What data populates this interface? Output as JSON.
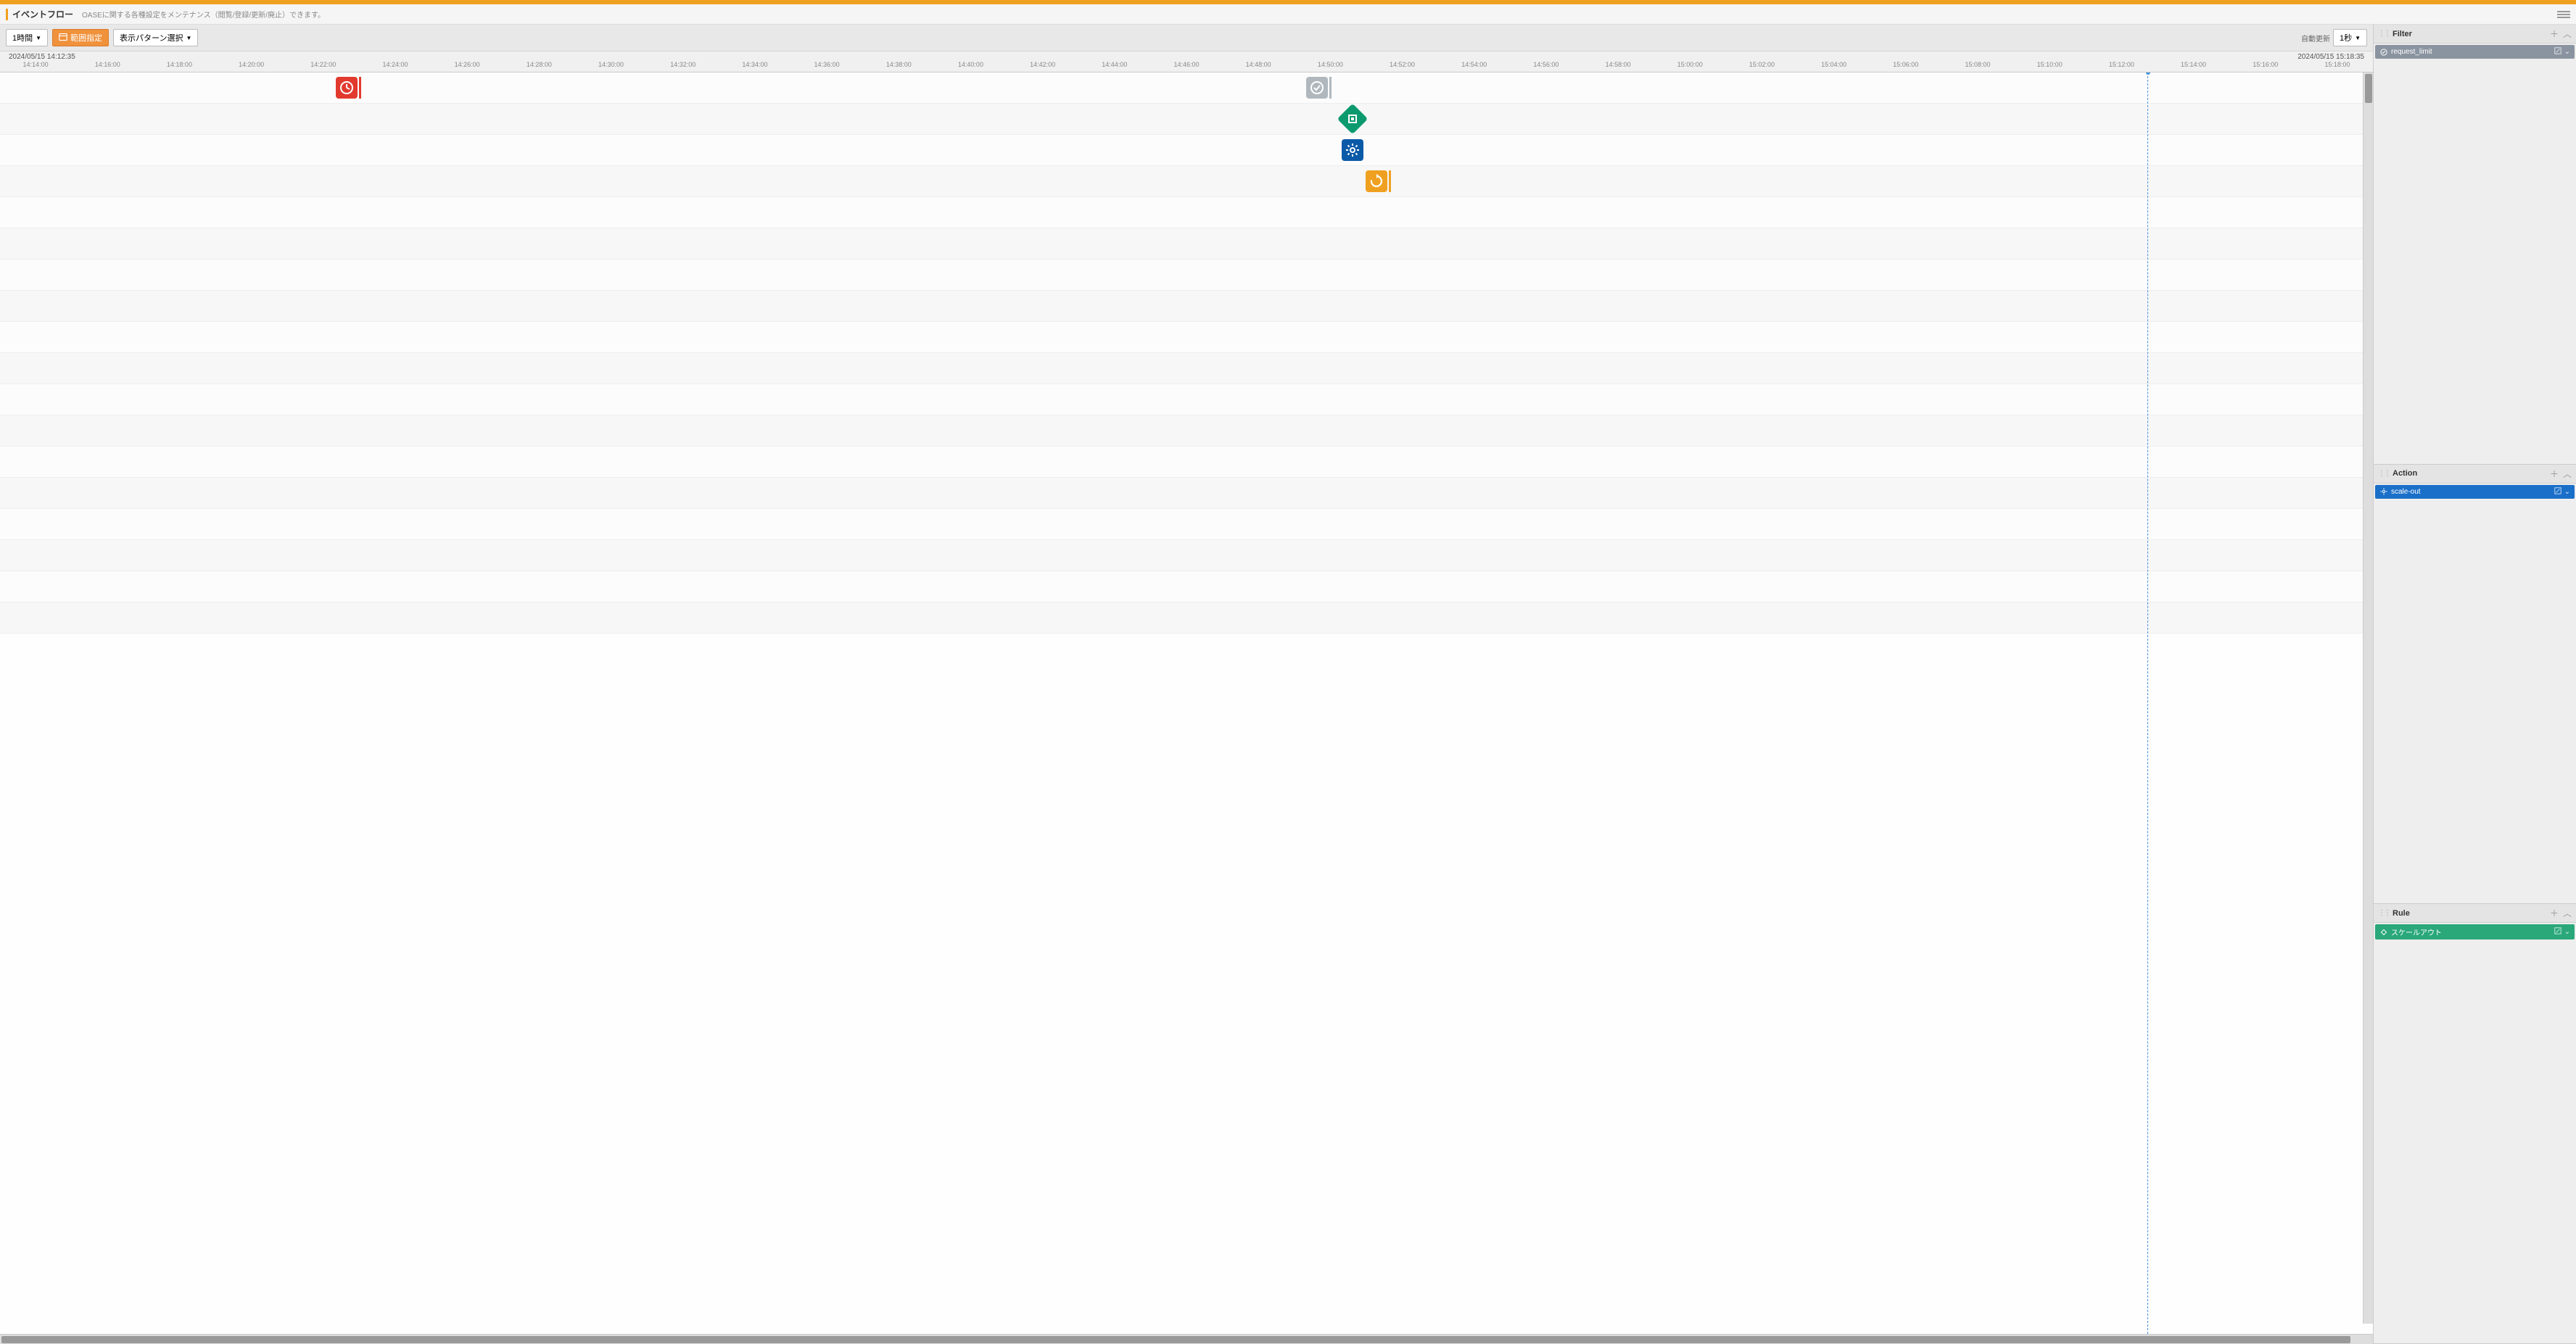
{
  "header": {
    "title": "イベントフロー",
    "description": "OASEに関する各種設定をメンテナンス（閲覧/登録/更新/廃止）できます。"
  },
  "toolbar": {
    "time_range_btn": "1時間",
    "range_specify_btn": "範囲指定",
    "pattern_select_btn": "表示パターン選択",
    "auto_refresh_label": "自動更新",
    "refresh_interval": "1秒"
  },
  "timeline": {
    "start_label": "2024/05/15 14:12:35",
    "end_label": "2024/05/15 15:18:35",
    "ticks": [
      "14:14:00",
      "14:16:00",
      "14:18:00",
      "14:20:00",
      "14:22:00",
      "14:24:00",
      "14:26:00",
      "14:28:00",
      "14:30:00",
      "14:32:00",
      "14:34:00",
      "14:36:00",
      "14:38:00",
      "14:40:00",
      "14:42:00",
      "14:44:00",
      "14:46:00",
      "14:48:00",
      "14:50:00",
      "14:52:00",
      "14:54:00",
      "14:56:00",
      "14:58:00",
      "15:00:00",
      "15:02:00",
      "15:04:00",
      "15:06:00",
      "15:08:00",
      "15:10:00",
      "15:12:00",
      "15:14:00",
      "15:16:00",
      "15:18:00"
    ],
    "now_position_pct": 90.5,
    "events": [
      {
        "row": 0,
        "pos_pct": 14.6,
        "type": "clock-red",
        "bar_color": "#e23a2e"
      },
      {
        "row": 0,
        "pos_pct": 55.5,
        "type": "check-gray",
        "bar_color": "#b0b8be"
      },
      {
        "row": 1,
        "pos_pct": 57.0,
        "type": "diamond-green",
        "bar_color": ""
      },
      {
        "row": 2,
        "pos_pct": 57.0,
        "type": "gear-blue",
        "bar_color": ""
      },
      {
        "row": 3,
        "pos_pct": 58.0,
        "type": "refresh-orange",
        "bar_color": "#f0a020"
      }
    ],
    "row_count": 18
  },
  "side": {
    "filter": {
      "title": "Filter",
      "items": [
        {
          "label": "request_limit",
          "color": "gray"
        }
      ]
    },
    "action": {
      "title": "Action",
      "items": [
        {
          "label": "scale-out",
          "color": "blue"
        }
      ]
    },
    "rule": {
      "title": "Rule",
      "items": [
        {
          "label": "スケールアウト",
          "color": "green"
        }
      ]
    }
  }
}
